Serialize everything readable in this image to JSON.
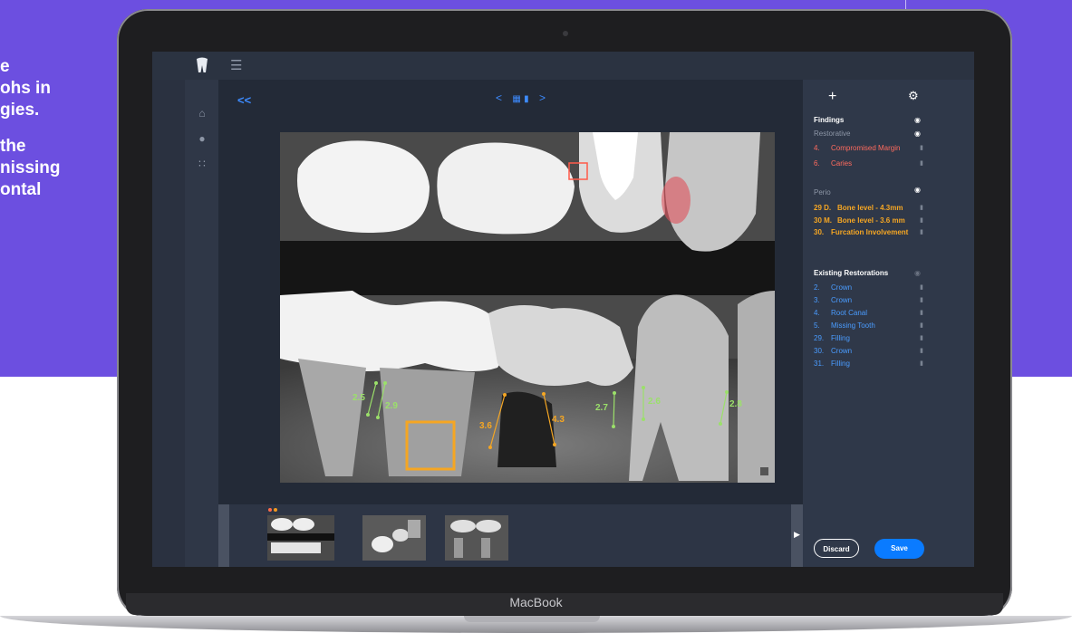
{
  "marketing": {
    "lines_a": [
      "e",
      "ohs in",
      "gies."
    ],
    "lines_b": [
      "the",
      "nissing",
      "ontal"
    ]
  },
  "laptop": {
    "brand": "MacBook"
  },
  "app": {
    "menu_icon": "hamburger-icon",
    "logo_icon": "tooth-icon",
    "nav_icons": [
      "home-icon",
      "user-icon",
      "apps-grid-icon"
    ],
    "collapse_label": "<<",
    "pager": {
      "prev": "<",
      "next": ">",
      "icons": [
        "grid-view-icon",
        "document-icon"
      ]
    },
    "xray_measurements": [
      {
        "label": "2.5",
        "color": "#9be06a"
      },
      {
        "label": "2.9",
        "color": "#9be06a"
      },
      {
        "label": "3.6",
        "color": "#f39a1f"
      },
      {
        "label": "4.3",
        "color": "#f39a1f"
      },
      {
        "label": "2.7",
        "color": "#9be06a"
      },
      {
        "label": "2.6",
        "color": "#9be06a"
      },
      {
        "label": "2.8",
        "color": "#9be06a"
      }
    ],
    "thumbnails_count": 3,
    "thumb_dot_colors": [
      "#ff6b4a",
      "#f39a1f"
    ]
  },
  "panel": {
    "plus": "+",
    "findings_title": "Findings",
    "restorative_label": "Restorative",
    "restorative": [
      {
        "num": "4.",
        "label": "Compromised Margin",
        "color": "#ff6b5e"
      },
      {
        "num": "6.",
        "label": "Caries",
        "color": "#ff6b5e"
      }
    ],
    "perio_label": "Perio",
    "perio": [
      {
        "num": "29 D.",
        "label": "Bone level - 4.3mm",
        "color": "#f5a623"
      },
      {
        "num": "30 M.",
        "label": "Bone level - 3.6 mm",
        "color": "#f5a623"
      },
      {
        "num": "30.",
        "label": "Furcation Involvement",
        "color": "#f5a623"
      }
    ],
    "existing_title": "Existing Restorations",
    "existing": [
      {
        "num": "2.",
        "label": "Crown"
      },
      {
        "num": "3.",
        "label": "Crown"
      },
      {
        "num": "4.",
        "label": "Root Canal"
      },
      {
        "num": "5.",
        "label": "Missing Tooth"
      },
      {
        "num": "29.",
        "label": "Filling"
      },
      {
        "num": "30.",
        "label": "Crown"
      },
      {
        "num": "31.",
        "label": "Filling"
      }
    ],
    "existing_color": "#4a9cff",
    "discard_label": "Discard",
    "save_label": "Save"
  },
  "colors": {
    "background": "#6c4fe0",
    "accent": "#0a7bff"
  }
}
